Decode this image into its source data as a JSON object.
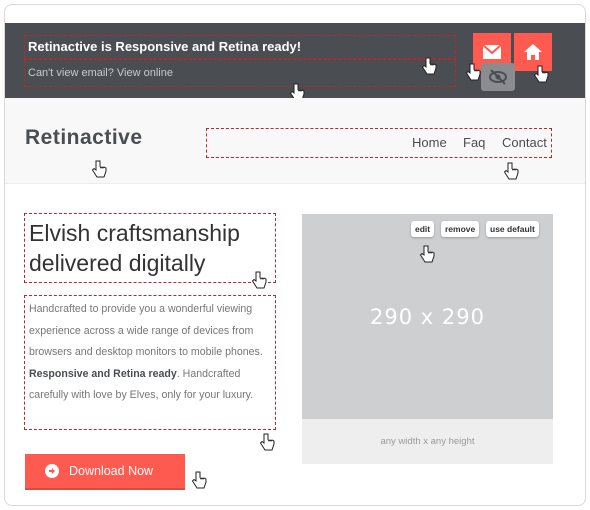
{
  "header": {
    "headline": "Retinactive is Responsive and Retina ready!",
    "subline": "Can't view email? View online",
    "buttons": [
      {
        "icon": "envelope-icon",
        "color": "#ff5a50"
      },
      {
        "icon": "home-icon",
        "color": "#ff5a50"
      }
    ],
    "background": "#4a4d52"
  },
  "nav": {
    "logo": "Retinactive",
    "links": [
      "Home",
      "Faq",
      "Contact"
    ]
  },
  "main": {
    "title_line1": "Elvish craftsmanship",
    "title_line2": "delivered digitally",
    "body_part1": "Handcrafted to provide you a wonderful viewing experience across a wide range of devices from browsers and desktop monitors to mobile phones.",
    "body_bold": "Responsive and Retina ready",
    "body_part2": ". Handcrafted carefully with love by Elves, only for your luxury.",
    "download_label": "Download Now",
    "accent": "#ff5a50"
  },
  "image": {
    "placeholder": "290 x 290",
    "caption": "any width x any height",
    "tools": [
      "edit",
      "remove",
      "use default"
    ]
  }
}
